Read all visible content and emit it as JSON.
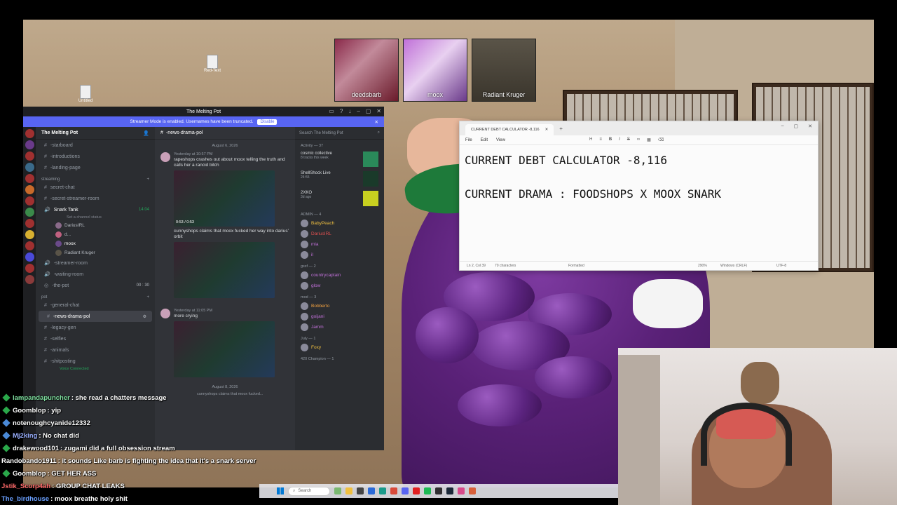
{
  "desktop": {
    "icons": [
      {
        "label": "Red-Text"
      },
      {
        "label": "Untitled"
      }
    ]
  },
  "cams": [
    {
      "name": "deedsbarb"
    },
    {
      "name": "moox"
    },
    {
      "name": "Radiant Kruger"
    }
  ],
  "discord": {
    "window_title": "The Melting Pot",
    "banner": {
      "text": "Streamer Mode is enabled. Usernames have been truncated.",
      "button": "Disable"
    },
    "server_name": "The Melting Pot",
    "channels_top": [
      "-starboard",
      "-introductions",
      "-landing-page"
    ],
    "streaming_category": "streaming",
    "streaming_channels": [
      "secret-chat",
      "-secret-streamer-room"
    ],
    "voice": {
      "name": "Snark Tank",
      "status": "Set a channel status",
      "timer": "14:04",
      "users": [
        "DariusIRL",
        "d...",
        "moox",
        "Radiant Kruger"
      ]
    },
    "channels_mid": [
      "-streamer-room",
      "-waiting-room",
      "-the-pot"
    ],
    "pot_timer": "00 : 30",
    "pot_category": "pot",
    "pot_channels": [
      "-general-chat",
      "-news-drama-pol",
      "-legacy-gen",
      "-selfies",
      "-animals",
      "-shitposting"
    ],
    "active_channel": "-news-drama-pol",
    "voice_connected": "Voice Connected",
    "chat_header": "-news-drama-pol",
    "search_placeholder": "Search The Melting Pot",
    "date1": "August 6, 2026",
    "date2": "August 8, 2026",
    "messages": [
      {
        "meta": "Yesterday at 10:57 PM",
        "text": "rapeshops crashes out about moox telling the truth and calls her a rancid bitch",
        "video_time": "0:53 / 0:53"
      },
      {
        "meta": "",
        "text": "cunnyshops claims that moox fucked her way into darius' orbit",
        "video_time": ""
      },
      {
        "meta": "Yesterday at 11:05 PM",
        "text": "more crying",
        "video_time": ""
      }
    ],
    "reply_preview": "cunnyshops claims that moox fucked...",
    "members": {
      "activity_header": "Activity — 37",
      "activities": [
        {
          "title": "cosmic collective",
          "sub": "8 tracks this week"
        },
        {
          "title": "ShellShock Live",
          "sub": "24:55"
        },
        {
          "title": "2XKO",
          "sub": "3d ago"
        }
      ],
      "admin_header": "ADMIN — 4",
      "admins": [
        "BabyPeach",
        "DariusIRL",
        "mia",
        "il"
      ],
      "gssf_header": "gssf — 2",
      "gssf": [
        "countrycaptain",
        "glow"
      ],
      "mod_header": "mod — 3",
      "mods": [
        "Bobberto",
        "goijani",
        "Jamm"
      ],
      "july_header": "July — 1",
      "july": [
        "Foxy"
      ],
      "champion_header": "420 Champion — 1"
    }
  },
  "notepad": {
    "tab_title": "CURRENT DEBT CALCULATOR -8,116",
    "menu": [
      "File",
      "Edit",
      "View"
    ],
    "line1": "CURRENT DEBT CALCULATOR -8,116",
    "line2": "CURRENT DRAMA : FOODSHOPS X MOOX SNARK",
    "status": {
      "pos": "Ln 2, Col 39",
      "chars": "70 characters",
      "format": "Formatted",
      "zoom": "290%",
      "eol": "Windows (CRLF)",
      "enc": "UTF-8"
    }
  },
  "stream_chat": [
    {
      "user": "lampandapuncher",
      "text": ": she read a chatters message"
    },
    {
      "user": "Goomblop",
      "text": ": yip"
    },
    {
      "user": "notenoughcyanide12332",
      "text": ""
    },
    {
      "user": "Mj2king",
      "text": ": No chat did"
    },
    {
      "user": "drakewood101",
      "text": ": zugami did a full obsession stream"
    },
    {
      "user": "Randobando1911",
      "text": ": it sounds Like barb is fighting the idea that it's a snark server"
    },
    {
      "user": "Goomblop",
      "text": ": GET HER ASS"
    },
    {
      "user": "Jstik_Scorp4ah",
      "text": ": GROUP CHAT LEAKS"
    },
    {
      "user": "The_birdhouse",
      "text": ": moox breathe holy shit"
    }
  ],
  "taskbar": {
    "search": "Search"
  }
}
